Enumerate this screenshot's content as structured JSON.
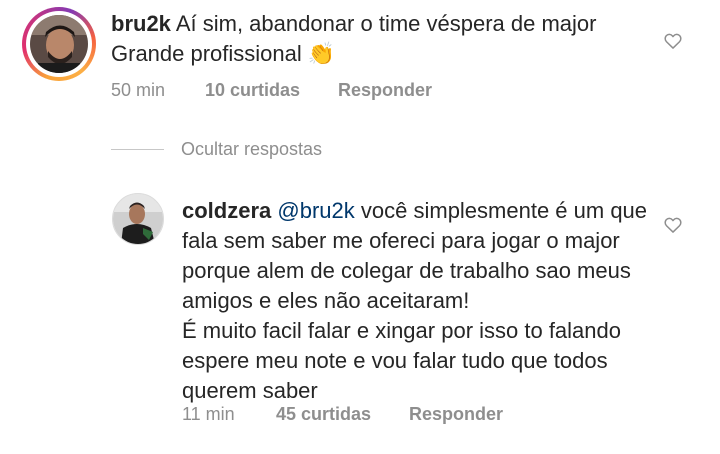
{
  "comments": [
    {
      "username": "bru2k",
      "text_lines": [
        "Aí sim, abandonar o time véspera de major",
        "Grande profissional"
      ],
      "emoji": "👏",
      "time": "50 min",
      "likes": "10 curtidas",
      "reply_label": "Responder",
      "like_icon": "heart-outline-icon"
    },
    {
      "username": "coldzera",
      "mention": "@bru2k",
      "text": "você simplesmente é um que fala sem saber me ofereci para jogar o major porque alem de colegar de trabalho sao meus amigos e eles não aceitaram!\nÉ muito facil falar e xingar por isso to falando espere meu note e vou falar tudo que todos querem saber",
      "time": "11 min",
      "likes": "45 curtidas",
      "reply_label": "Responder",
      "like_icon": "heart-outline-icon"
    }
  ],
  "replies_toggle": {
    "label": "Ocultar respostas"
  },
  "colors": {
    "text": "#262626",
    "secondary": "#8e8e8e",
    "mention": "#00376b",
    "story_ring": "#e1306c"
  }
}
